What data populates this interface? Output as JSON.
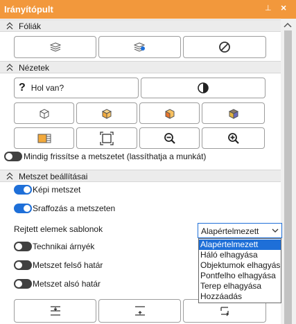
{
  "panel": {
    "title": "Irányítópult",
    "pin_glyph": "⊥",
    "close_glyph": "×"
  },
  "sections": {
    "folia": "Fóliák",
    "nezetek": "Nézetek",
    "metszet": "Metszet beállításai"
  },
  "folia_buttons": [
    {
      "icon": "layers-icon"
    },
    {
      "icon": "layer-settings-icon"
    },
    {
      "icon": "no-entry-icon"
    }
  ],
  "nezetek": {
    "hol_van_label": "Hol van?",
    "contrast_icon": "contrast-icon",
    "view_icons": [
      "cube-icon",
      "cube-front-icon",
      "cube-section-icon",
      "cube-shaded-icon",
      "film-strip-icon",
      "zoom-extents-icon",
      "zoom-out-icon",
      "zoom-in-icon"
    ],
    "always_refresh_label": "Mindig frissítse a metszetet  (lassíthatja a munkát)",
    "always_refresh_on": false
  },
  "metszet": {
    "kepi_label": "Képi metszet",
    "kepi_on": true,
    "sraffozas_label": "Sraffozás a metszeten",
    "sraffozas_on": true,
    "rejtett_label": "Rejtett elemek sablonok",
    "technikai_label": "Technikai árnyék",
    "technikai_on": false,
    "felso_label": "Metszet felső határ",
    "felso_on": false,
    "also_label": "Metszet alsó határ",
    "also_on": false
  },
  "template_select": {
    "value": "Alapértelmezett",
    "options": [
      "Alapértelmezett",
      "Háló elhagyása",
      "Objektumok elhagyás",
      "Pontfelho elhagyása",
      "Terep elhagyása",
      "Hozzáadás"
    ]
  },
  "bottom_buttons": [
    {
      "icon": "align-center-icon"
    },
    {
      "icon": "align-bottom-icon"
    },
    {
      "icon": "flip-icon"
    }
  ],
  "colors": {
    "title_bar": "#f2983c",
    "accent": "#1e6fd8",
    "toggle_off": "#404040"
  }
}
